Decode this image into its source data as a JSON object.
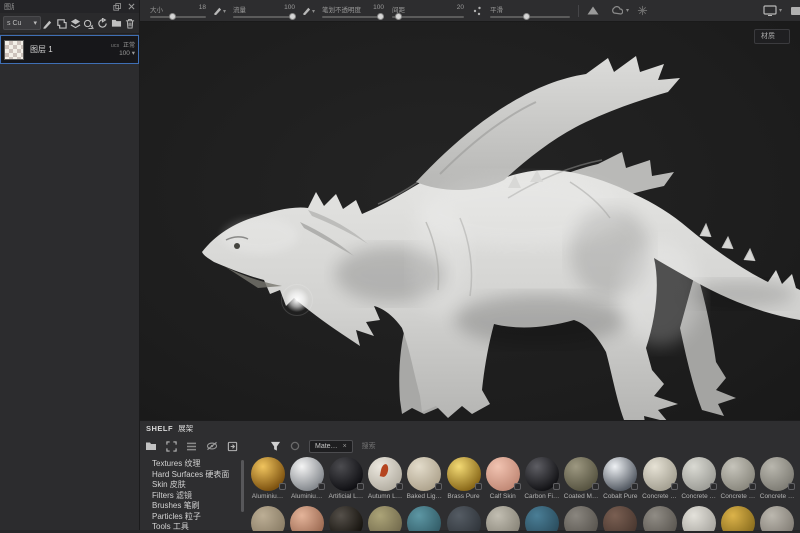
{
  "layers_panel": {
    "title": "图层",
    "dock_icon": "dock",
    "close_icon": "close",
    "channel_dropdown": {
      "value": "s Cu",
      "caret": "▾"
    },
    "layer": {
      "name": "图层 1",
      "blend_tag": "ucs",
      "blend_mode": "正常",
      "opacity": "100",
      "opacity_caret": "▾"
    }
  },
  "toolbar": {
    "size": {
      "label": "大小",
      "value": "18",
      "pos": 40
    },
    "flow": {
      "label": "流量",
      "value": "100",
      "pos": 95
    },
    "stroke_opacity": {
      "label": "笔划不透明度",
      "value": "100",
      "pos": 93
    },
    "spacing": {
      "label": "间距",
      "value": "20",
      "pos": 8
    },
    "smooth": {
      "label": "平滑",
      "value": "",
      "pos": 45
    },
    "caret": "▾"
  },
  "viewport": {
    "mode_label": "材质"
  },
  "shelf": {
    "title_en": "SHELF",
    "title_zh": "展架",
    "filter_chip": "Mate…",
    "chip_close": "×",
    "search_placeholder": "搜索",
    "categories": [
      {
        "en": "Textures",
        "zh": "纹理"
      },
      {
        "en": "Hard Surfaces",
        "zh": "硬表面"
      },
      {
        "en": "Skin",
        "zh": "皮肤"
      },
      {
        "en": "Filters",
        "zh": "滤镜"
      },
      {
        "en": "Brushes",
        "zh": "笔刷"
      },
      {
        "en": "Particles",
        "zh": "粒子"
      },
      {
        "en": "Tools",
        "zh": "工具"
      }
    ],
    "materials_row1": [
      {
        "label": "Aluminiu…",
        "c1": "#f0c45e",
        "c2": "#7d5210"
      },
      {
        "label": "Aluminiu…",
        "c1": "#f4f4f4",
        "c2": "#85898e"
      },
      {
        "label": "Artificial L…",
        "c1": "#4c4c50",
        "c2": "#101014"
      },
      {
        "label": "Autumn L…",
        "c1": "#ece8df",
        "c2": "#b5b0a4",
        "accent": "#b5441f"
      },
      {
        "label": "Baked Lig…",
        "c1": "#e3dccb",
        "c2": "#b0a58f"
      },
      {
        "label": "Brass Pure",
        "c1": "#f3da74",
        "c2": "#8a691a"
      },
      {
        "label": "Calf Skin",
        "c1": "#f1c3b1",
        "c2": "#c28a77"
      },
      {
        "label": "Carbon Fi…",
        "c1": "#5e5e64",
        "c2": "#131316"
      },
      {
        "label": "Coated M…",
        "c1": "#9d9881",
        "c2": "#585542"
      },
      {
        "label": "Cobalt Pure",
        "c1": "#eef1f4",
        "c2": "#555b64"
      },
      {
        "label": "Concrete …",
        "c1": "#e6e2d5",
        "c2": "#a5a193"
      },
      {
        "label": "Concrete …",
        "c1": "#dadad3",
        "c2": "#9e9e98"
      },
      {
        "label": "Concrete …",
        "c1": "#c6c4bb",
        "c2": "#8b897f"
      },
      {
        "label": "Concrete …",
        "c1": "#b9b7ae",
        "c2": "#807e76"
      }
    ],
    "materials_row2": [
      {
        "c1": "#bcae95",
        "c2": "#8a7d66"
      },
      {
        "c1": "#e4b49a",
        "c2": "#9c6a52"
      },
      {
        "c1": "#55504a",
        "c2": "#16130e"
      },
      {
        "c1": "#aca478",
        "c2": "#746c4e"
      },
      {
        "c1": "#5d97a4",
        "c2": "#335d68"
      },
      {
        "c1": "#555c64",
        "c2": "#31363c"
      },
      {
        "c1": "#c2beb2",
        "c2": "#8a867a"
      },
      {
        "c1": "#4a7e96",
        "c2": "#2b4d5e"
      },
      {
        "c1": "#8a867f",
        "c2": "#5a5650"
      },
      {
        "c1": "#7a5f52",
        "c2": "#4a3830"
      },
      {
        "c1": "#908c85",
        "c2": "#5c5852"
      },
      {
        "c1": "#e4e2db",
        "c2": "#a8a6a0"
      },
      {
        "c1": "#dcb34a",
        "c2": "#8a6d1e"
      },
      {
        "c1": "#bcb8af",
        "c2": "#847f77"
      }
    ]
  }
}
